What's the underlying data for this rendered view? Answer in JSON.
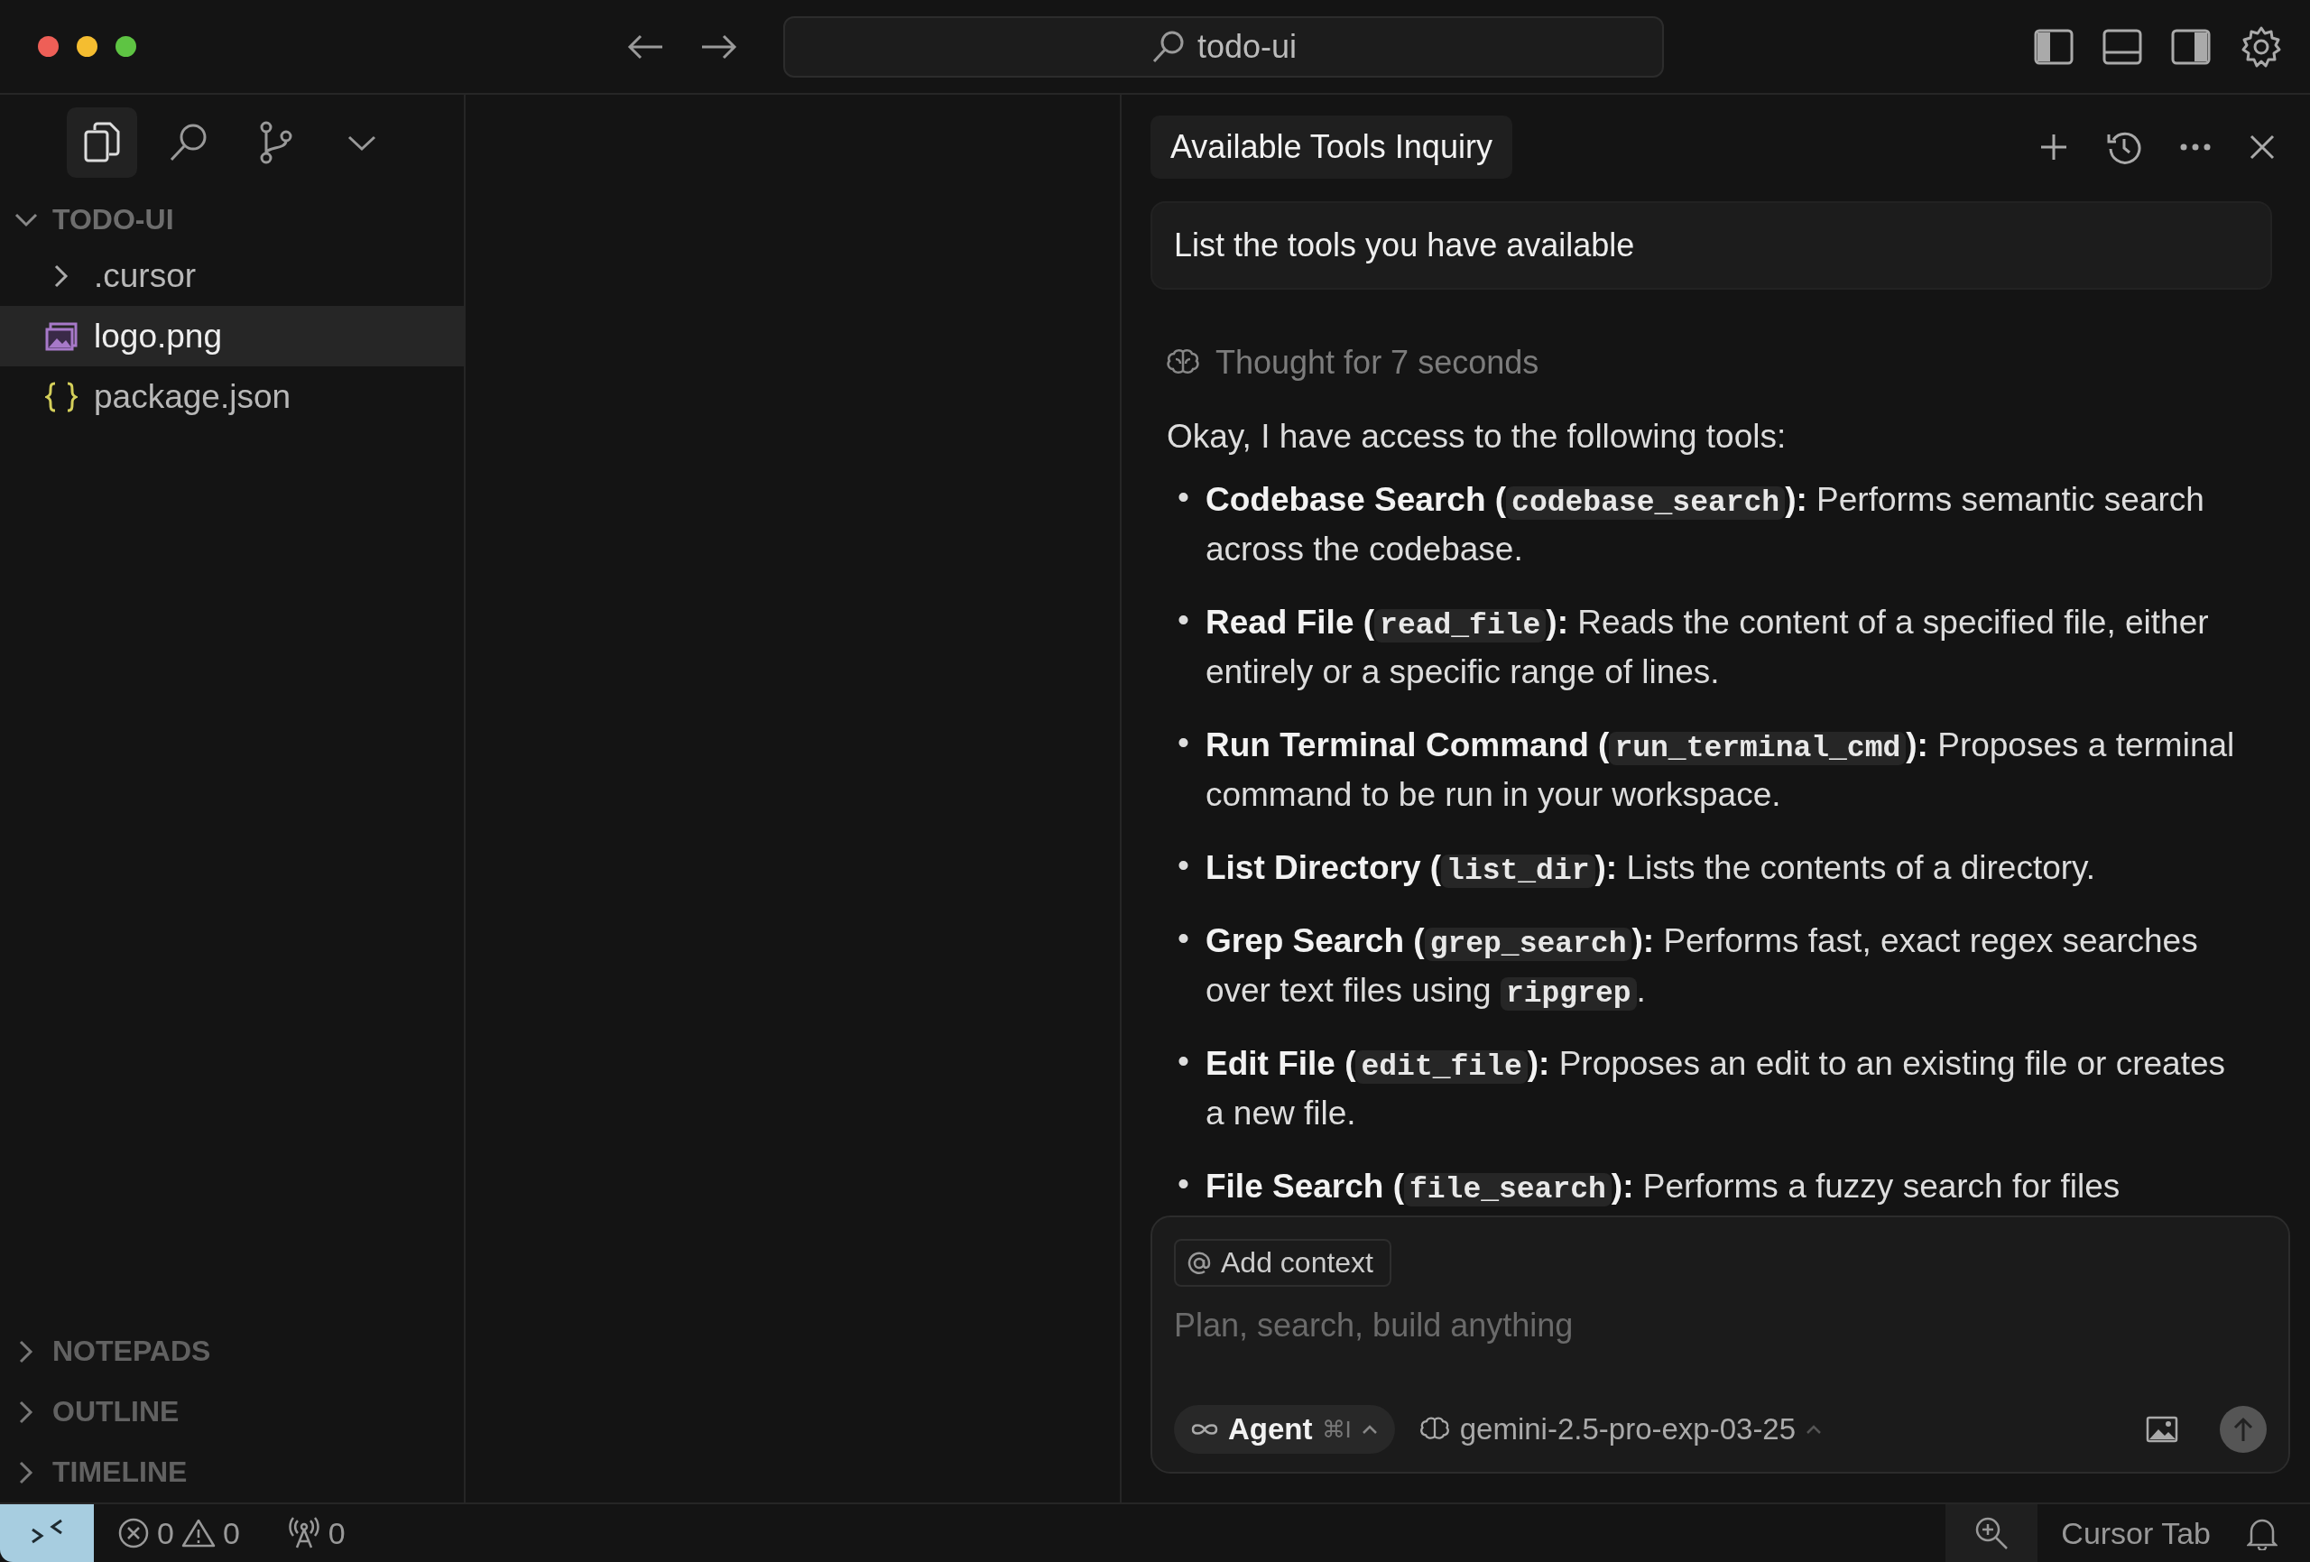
{
  "window": {
    "search": "todo-ui"
  },
  "activity": [
    {
      "kind": "files",
      "selected": true
    },
    {
      "kind": "search",
      "selected": false
    },
    {
      "kind": "branch",
      "selected": false
    },
    {
      "kind": "more",
      "selected": false
    }
  ],
  "sidebar": {
    "project": {
      "name": "TODO-UI",
      "expanded": true
    },
    "files": [
      {
        "name": ".cursor",
        "kind": "folder",
        "expanded": false,
        "selected": false
      },
      {
        "name": "logo.png",
        "kind": "image",
        "selected": true
      },
      {
        "name": "package.json",
        "kind": "json",
        "selected": false
      }
    ],
    "sections": [
      {
        "name": "NOTEPADS",
        "expanded": false
      },
      {
        "name": "OUTLINE",
        "expanded": false
      },
      {
        "name": "TIMELINE",
        "expanded": false
      }
    ]
  },
  "chat": {
    "title": "Available Tools Inquiry",
    "user_message": "List the tools you have available",
    "thought": "Thought for 7 seconds",
    "intro": "Okay, I have access to the following tools:",
    "bullet": "•",
    "tools": [
      [
        {
          "kind": "bold",
          "text": "Codebase Search ("
        },
        {
          "kind": "code",
          "text": "codebase_search"
        },
        {
          "kind": "bold",
          "text": "):"
        },
        {
          "kind": "text",
          "text": " Performs semantic search across the codebase."
        }
      ],
      [
        {
          "kind": "bold",
          "text": "Read File ("
        },
        {
          "kind": "code",
          "text": "read_file"
        },
        {
          "kind": "bold",
          "text": "):"
        },
        {
          "kind": "text",
          "text": " Reads the content of a specified file, either entirely or a specific range of lines."
        }
      ],
      [
        {
          "kind": "bold",
          "text": "Run Terminal Command ("
        },
        {
          "kind": "code",
          "text": "run_terminal_cmd"
        },
        {
          "kind": "bold",
          "text": "):"
        },
        {
          "kind": "text",
          "text": " Proposes a terminal command to be run in your workspace."
        }
      ],
      [
        {
          "kind": "bold",
          "text": "List Directory ("
        },
        {
          "kind": "code",
          "text": "list_dir"
        },
        {
          "kind": "bold",
          "text": "):"
        },
        {
          "kind": "text",
          "text": " Lists the contents of a directory."
        }
      ],
      [
        {
          "kind": "bold",
          "text": "Grep Search ("
        },
        {
          "kind": "code",
          "text": "grep_search"
        },
        {
          "kind": "bold",
          "text": "):"
        },
        {
          "kind": "text",
          "text": " Performs fast, exact regex searches over text files using "
        },
        {
          "kind": "code",
          "text": "ripgrep"
        },
        {
          "kind": "text",
          "text": "."
        }
      ],
      [
        {
          "kind": "bold",
          "text": "Edit File ("
        },
        {
          "kind": "code",
          "text": "edit_file"
        },
        {
          "kind": "bold",
          "text": "):"
        },
        {
          "kind": "text",
          "text": " Proposes an edit to an existing file or creates a new file."
        }
      ],
      [
        {
          "kind": "bold",
          "text": "File Search ("
        },
        {
          "kind": "code",
          "text": "file_search"
        },
        {
          "kind": "bold",
          "text": "):"
        },
        {
          "kind": "text",
          "text": " Performs a fuzzy search for files"
        }
      ]
    ],
    "composer": {
      "context_button": "Add context",
      "placeholder": "Plan, search, build anything",
      "mode": "Agent",
      "shortcut": "⌘I",
      "model": "gemini-2.5-pro-exp-03-25"
    }
  },
  "status_bar": {
    "errors": "0",
    "warnings": "0",
    "ports": "0",
    "cursor_tab": "Cursor Tab"
  }
}
